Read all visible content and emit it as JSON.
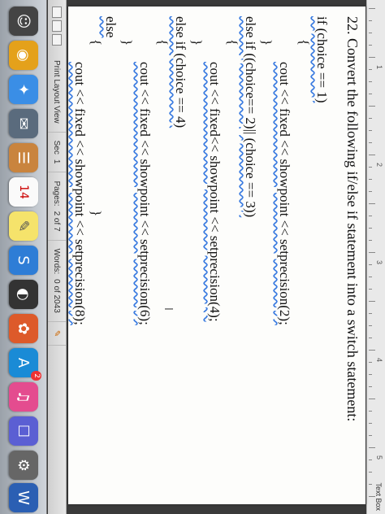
{
  "window": {
    "text_box_label": "Text Box"
  },
  "ruler": {
    "numbers": [
      "1",
      "2",
      "3",
      "4",
      "5"
    ]
  },
  "document": {
    "question": "22. Convert the following if/else if statement into a switch statement:",
    "code": [
      "if (choice == 1)",
      "{",
      "cout << fixed << showpoint << setprecision(2);",
      "}",
      "else if ((choice== 2)|| (choice == 3))",
      "{",
      "cout << fixed<< showpoint << setprecision(4);",
      "}",
      "else if (choice == 4)",
      "{",
      "cout << fixed << showpoint << setprecision(6);",
      "}",
      "else",
      "{",
      "cout << fixed << showpoint << setprecision(8);",
      "}"
    ]
  },
  "status_bar": {
    "view_label": "Print Layout View",
    "sec_label": "Sec",
    "sec_value": "1",
    "pages_label": "Pages:",
    "pages_value": "2 of 7",
    "words_label": "Words:",
    "words_value": "0 of 2043"
  },
  "dock": {
    "calendar_day": "14",
    "badge_count": "2"
  },
  "colors": {
    "page": "#fdfdfb",
    "spell_underline": "#3a7be0",
    "dock_bg": "#b6bcc3"
  }
}
